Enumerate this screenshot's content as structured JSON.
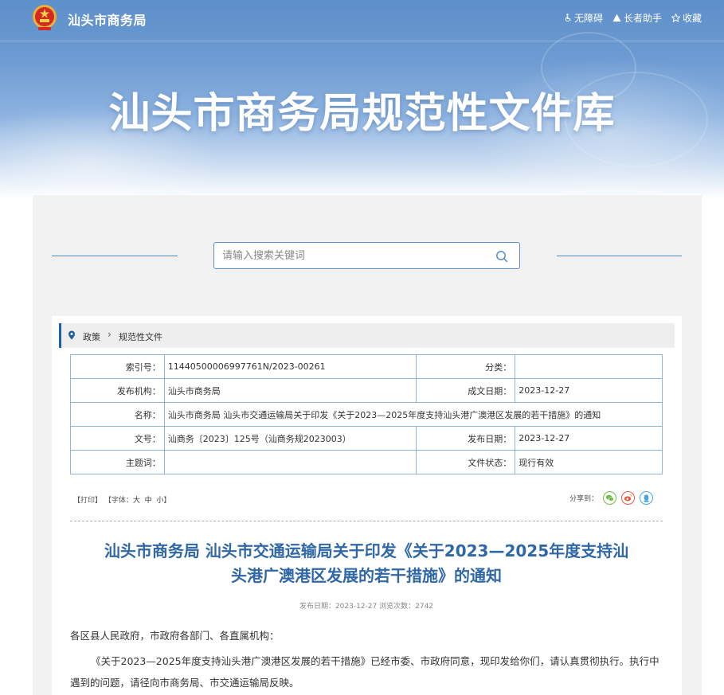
{
  "header": {
    "site_name": "汕头市商务局",
    "banner_title": "汕头市商务局规范性文件库",
    "links": [
      {
        "label": "无障碍",
        "icon": "accessibility-icon"
      },
      {
        "label": "长者助手",
        "icon": "elder-assist-icon"
      },
      {
        "label": "收藏",
        "icon": "star-icon"
      }
    ]
  },
  "search": {
    "placeholder": "请输入搜索关键词",
    "value": ""
  },
  "breadcrumb": {
    "items": [
      "政策",
      "规范性文件"
    ],
    "separator": "›"
  },
  "meta": {
    "index_label": "索引号：",
    "index_value": "11440500006997761N/2023-00261",
    "category_label": "分类：",
    "category_value": "",
    "publisher_label": "发布机构：",
    "publisher_value": "汕头市商务局",
    "created_label": "成文日期：",
    "created_value": "2023-12-27",
    "name_label": "名称：",
    "name_value": "汕头市商务局 汕头市交通运输局关于印发《关于2023—2025年度支持汕头港广澳港区发展的若干措施》的通知",
    "docno_label": "文号：",
    "docno_value": "汕商务〔2023〕125号（汕商务规2023003）",
    "pubdate_label": "发布日期：",
    "pubdate_value": "2023-12-27",
    "subject_label": "主题词：",
    "subject_value": "",
    "status_label": "文件状态：",
    "status_value": "现行有效"
  },
  "tools": {
    "print": "【打印】",
    "font_prefix": "【字体：",
    "large": "大",
    "medium": "中",
    "small": "小",
    "font_suffix": "】",
    "share_label": "分享到："
  },
  "article": {
    "title_line1": "汕头市商务局 汕头市交通运输局关于印发《关于2023—2025年度支持汕",
    "title_line2": "头港广澳港区发展的若干措施》的通知",
    "meta": "发布日期：2023-12-27  浏览次数：2742",
    "para1": "各区县人民政府，市政府各部门、各直属机构：",
    "para2": "《关于2023—2025年度支持汕头港广澳港区发展的若干措施》已经市委、市政府同意，现印发给你们，请认真贯彻执行。执行中遇到的问题，请径向市商务局、市交通运输局反映。"
  },
  "colors": {
    "accent": "#2f67a7",
    "table_border": "#8fb4da",
    "wechat": "#6dbd45",
    "weibo": "#e8593c",
    "qq": "#4aa6e0"
  }
}
